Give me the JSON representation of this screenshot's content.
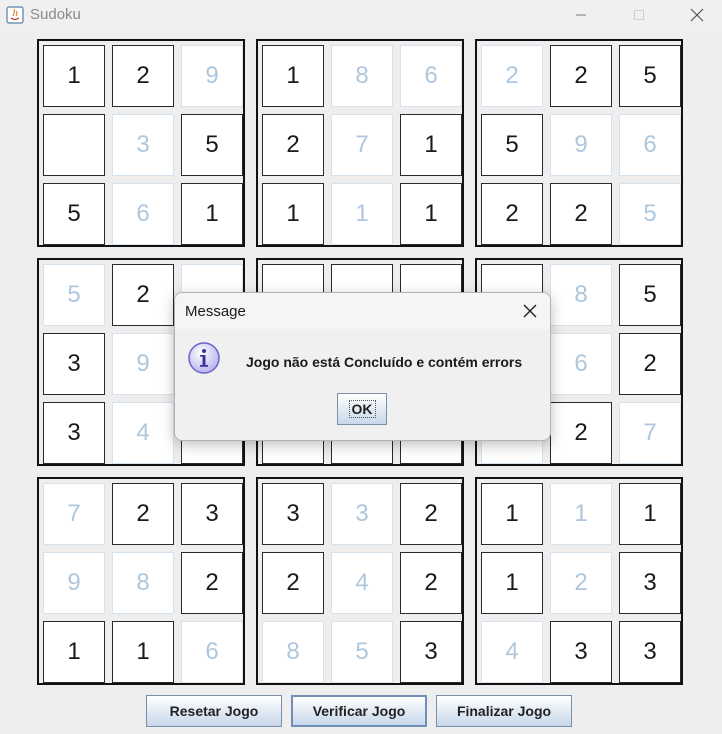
{
  "window": {
    "title": "Sudoku",
    "minimize_icon": "minimize-icon",
    "maximize_icon": "maximize-icon",
    "close_icon": "close-icon"
  },
  "board": {
    "cells": [
      [
        {
          "v": "1",
          "fixed": true
        },
        {
          "v": "2",
          "fixed": true
        },
        {
          "v": "9",
          "fixed": false
        },
        {
          "v": "1",
          "fixed": true
        },
        {
          "v": "8",
          "fixed": false
        },
        {
          "v": "6",
          "fixed": false
        },
        {
          "v": "2",
          "fixed": false
        },
        {
          "v": "2",
          "fixed": true
        },
        {
          "v": "5",
          "fixed": true
        }
      ],
      [
        {
          "v": "",
          "fixed": true
        },
        {
          "v": "3",
          "fixed": false
        },
        {
          "v": "5",
          "fixed": true
        },
        {
          "v": "2",
          "fixed": true
        },
        {
          "v": "7",
          "fixed": false
        },
        {
          "v": "1",
          "fixed": true
        },
        {
          "v": "5",
          "fixed": true
        },
        {
          "v": "9",
          "fixed": false
        },
        {
          "v": "6",
          "fixed": false
        }
      ],
      [
        {
          "v": "5",
          "fixed": true
        },
        {
          "v": "6",
          "fixed": false
        },
        {
          "v": "1",
          "fixed": true
        },
        {
          "v": "1",
          "fixed": true
        },
        {
          "v": "1",
          "fixed": false
        },
        {
          "v": "1",
          "fixed": true
        },
        {
          "v": "2",
          "fixed": true
        },
        {
          "v": "2",
          "fixed": true
        },
        {
          "v": "5",
          "fixed": false
        }
      ],
      [
        {
          "v": "5",
          "fixed": false
        },
        {
          "v": "2",
          "fixed": true
        },
        {
          "v": "",
          "fixed": false
        },
        {
          "v": "",
          "fixed": true
        },
        {
          "v": "",
          "fixed": true
        },
        {
          "v": "",
          "fixed": true
        },
        {
          "v": "",
          "fixed": true
        },
        {
          "v": "8",
          "fixed": false
        },
        {
          "v": "5",
          "fixed": true
        }
      ],
      [
        {
          "v": "3",
          "fixed": true
        },
        {
          "v": "9",
          "fixed": false
        },
        {
          "v": "",
          "fixed": true
        },
        {
          "v": "",
          "fixed": true
        },
        {
          "v": "",
          "fixed": true
        },
        {
          "v": "",
          "fixed": true
        },
        {
          "v": "",
          "fixed": true
        },
        {
          "v": "6",
          "fixed": false
        },
        {
          "v": "2",
          "fixed": true
        }
      ],
      [
        {
          "v": "3",
          "fixed": true
        },
        {
          "v": "4",
          "fixed": false
        },
        {
          "v": "",
          "fixed": true
        },
        {
          "v": "",
          "fixed": true
        },
        {
          "v": "",
          "fixed": true
        },
        {
          "v": "",
          "fixed": true
        },
        {
          "v": "",
          "fixed": false
        },
        {
          "v": "2",
          "fixed": true
        },
        {
          "v": "7",
          "fixed": false
        }
      ],
      [
        {
          "v": "7",
          "fixed": false
        },
        {
          "v": "2",
          "fixed": true
        },
        {
          "v": "3",
          "fixed": true
        },
        {
          "v": "3",
          "fixed": true
        },
        {
          "v": "3",
          "fixed": false
        },
        {
          "v": "2",
          "fixed": true
        },
        {
          "v": "1",
          "fixed": true
        },
        {
          "v": "1",
          "fixed": false
        },
        {
          "v": "1",
          "fixed": true
        }
      ],
      [
        {
          "v": "9",
          "fixed": false
        },
        {
          "v": "8",
          "fixed": false
        },
        {
          "v": "2",
          "fixed": true
        },
        {
          "v": "2",
          "fixed": true
        },
        {
          "v": "4",
          "fixed": false
        },
        {
          "v": "2",
          "fixed": true
        },
        {
          "v": "1",
          "fixed": true
        },
        {
          "v": "2",
          "fixed": false
        },
        {
          "v": "3",
          "fixed": true
        }
      ],
      [
        {
          "v": "1",
          "fixed": true
        },
        {
          "v": "1",
          "fixed": true
        },
        {
          "v": "6",
          "fixed": false
        },
        {
          "v": "8",
          "fixed": false
        },
        {
          "v": "5",
          "fixed": false
        },
        {
          "v": "3",
          "fixed": true
        },
        {
          "v": "4",
          "fixed": false
        },
        {
          "v": "3",
          "fixed": true
        },
        {
          "v": "3",
          "fixed": true
        }
      ]
    ]
  },
  "buttons": {
    "reset": "Resetar Jogo",
    "verify": "Verificar Jogo",
    "finish": "Finalizar Jogo"
  },
  "dialog": {
    "title": "Message",
    "message": "Jogo não está Concluído e contém errors",
    "ok": "OK",
    "icon": "info-icon"
  },
  "colors": {
    "fixed_text": "#1a1a1a",
    "editable_text": "#aec6de",
    "button_gradient_bottom": "#c7d7ea"
  }
}
